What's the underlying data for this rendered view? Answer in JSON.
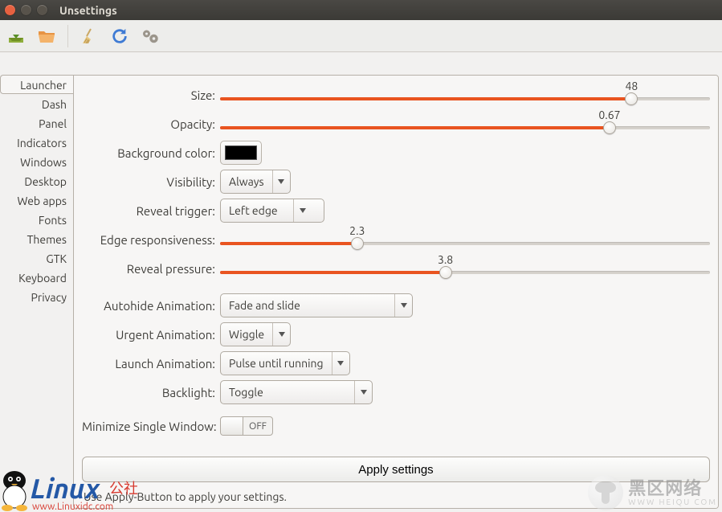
{
  "window": {
    "title": "Unsettings"
  },
  "titlebar": {
    "close_color": "#e76140",
    "min_color": "#58534b",
    "max_color": "#58534b"
  },
  "toolbar": {
    "icons": [
      {
        "name": "import-icon"
      },
      {
        "name": "folder-open-icon"
      },
      {
        "name": "broom-icon"
      },
      {
        "name": "refresh-icon"
      },
      {
        "name": "gears-icon"
      }
    ]
  },
  "sidebar": {
    "tabs": [
      {
        "label": "Launcher",
        "active": true
      },
      {
        "label": "Dash"
      },
      {
        "label": "Panel"
      },
      {
        "label": "Indicators"
      },
      {
        "label": "Windows"
      },
      {
        "label": "Desktop"
      },
      {
        "label": "Web apps"
      },
      {
        "label": "Fonts"
      },
      {
        "label": "Themes"
      },
      {
        "label": "GTK"
      },
      {
        "label": "Keyboard"
      },
      {
        "label": "Privacy"
      }
    ]
  },
  "launcher": {
    "size": {
      "label": "Size:",
      "value": "48",
      "percent": 84
    },
    "opacity": {
      "label": "Opacity:",
      "value": "0.67",
      "percent": 79.5
    },
    "background_color": {
      "label": "Background color:",
      "value": "#000000"
    },
    "visibility": {
      "label": "Visibility:",
      "value": "Always"
    },
    "reveal_trigger": {
      "label": "Reveal trigger:",
      "value": "Left edge"
    },
    "edge_responsiveness": {
      "label": "Edge responsiveness:",
      "value": "2.3",
      "percent": 28
    },
    "reveal_pressure": {
      "label": "Reveal pressure:",
      "value": "3.8",
      "percent": 46
    },
    "autohide_animation": {
      "label": "Autohide Animation:",
      "value": "Fade and slide"
    },
    "urgent_animation": {
      "label": "Urgent Animation:",
      "value": "Wiggle"
    },
    "launch_animation": {
      "label": "Launch Animation:",
      "value": "Pulse until running"
    },
    "backlight": {
      "label": "Backlight:",
      "value": "Toggle"
    },
    "minimize_single": {
      "label": "Minimize Single Window:",
      "value": "OFF"
    },
    "apply_label": "Apply settings",
    "footer_hint": "Use Apply-Button to apply your settings."
  },
  "watermark": {
    "left_main": "Linux",
    "left_tag": "公社",
    "left_url": "www.Linuxidc.com",
    "right_main": "黑区网络",
    "right_sub": "WWW  HEIQU  COM"
  },
  "accent_color": "#e95420"
}
